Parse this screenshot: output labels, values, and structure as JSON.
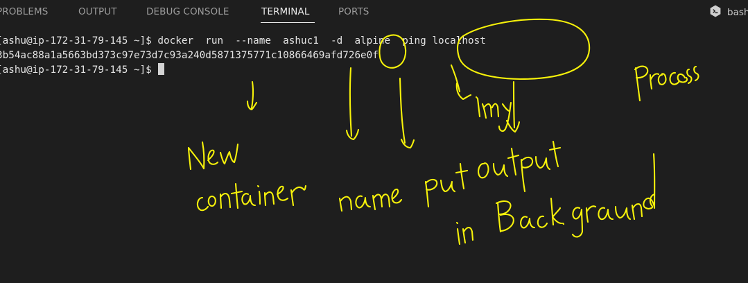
{
  "panel": {
    "tabs": [
      {
        "label": "PROBLEMS",
        "active": false
      },
      {
        "label": "OUTPUT",
        "active": false
      },
      {
        "label": "DEBUG CONSOLE",
        "active": false
      },
      {
        "label": "TERMINAL",
        "active": true
      },
      {
        "label": "PORTS",
        "active": false
      }
    ],
    "shell": {
      "label": "bash",
      "icon": "terminal-shell-icon"
    }
  },
  "terminal": {
    "lines": [
      "[ashu@ip-172-31-79-145 ~]$ docker  run  --name  ashuc1  -d  alpine  ping localhost",
      "3b54ac88a1a5663bd373c97e73d7c93a240d5871375771c10866469afd726e0f",
      "[ashu@ip-172-31-79-145 ~]$ "
    ]
  },
  "annotations": {
    "color": "#f7f20a",
    "words": [
      "New",
      "container",
      "name",
      "put output",
      "in Background",
      "Img",
      "process"
    ]
  }
}
